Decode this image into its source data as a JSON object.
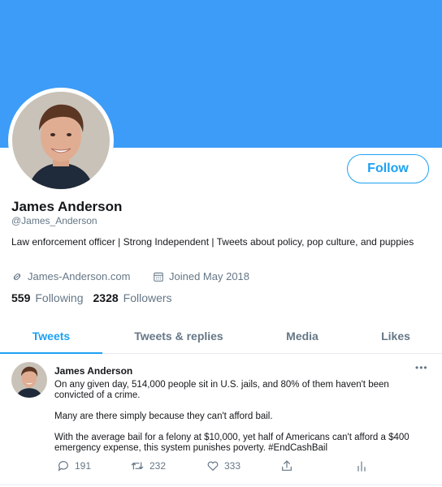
{
  "profile": {
    "name": "James Anderson",
    "handle": "@James_Anderson",
    "bio": "Law enforcement officer | Strong Independent | Tweets about policy, pop culture, and puppies",
    "website": "James-Anderson.com",
    "joined": "Joined May 2018",
    "following_count": "559",
    "following_label": "Following",
    "followers_count": "2328",
    "followers_label": "Followers",
    "follow_label": "Follow",
    "link_icon": "link-icon",
    "calendar_icon": "calendar-icon"
  },
  "tabs": [
    {
      "label": "Tweets",
      "active": true
    },
    {
      "label": "Tweets & replies",
      "active": false
    },
    {
      "label": "Media",
      "active": false
    },
    {
      "label": "Likes",
      "active": false
    }
  ],
  "tweet": {
    "author": "James Anderson",
    "more_label": "•••",
    "paragraphs": [
      "On any given day, 514,000 people sit in U.S. jails, and 80% of them haven't been convicted of a crime.",
      "Many are there simply because they can't afford bail.",
      "With the average bail for a felony at $10,000, yet half of Americans can't afford a $400 emergency expense, this system punishes poverty. #EndCashBail"
    ],
    "replies": "191",
    "retweets": "232",
    "likes": "333"
  },
  "colors": {
    "banner": "#3d9cf7",
    "accent": "#1da1f2",
    "muted": "#657786"
  }
}
